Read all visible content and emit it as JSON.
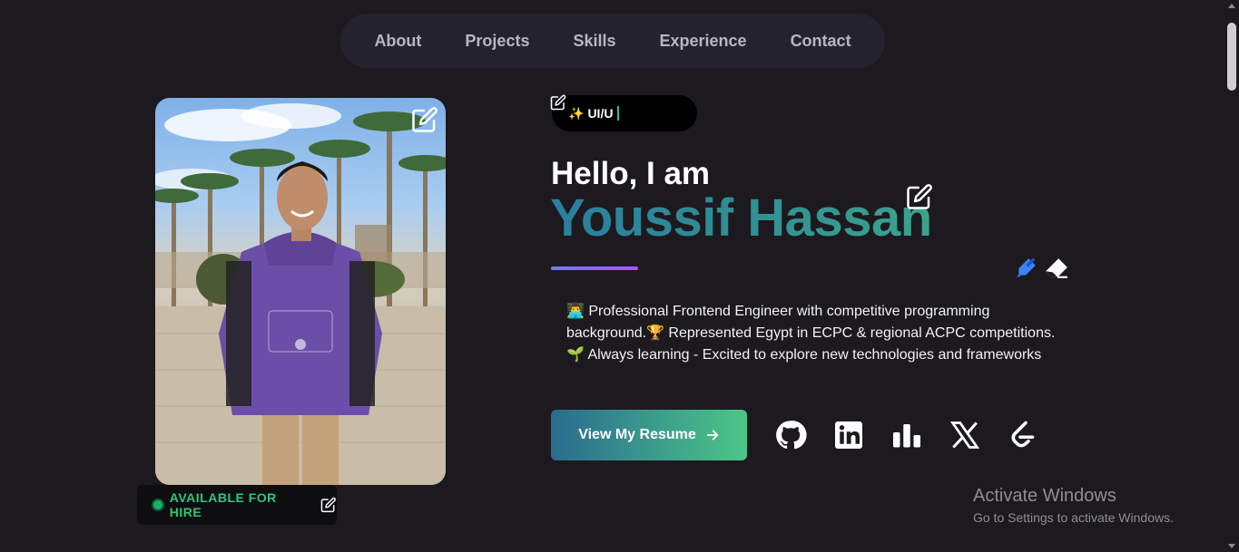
{
  "nav": {
    "items": [
      {
        "label": "About"
      },
      {
        "label": "Projects"
      },
      {
        "label": "Skills"
      },
      {
        "label": "Experience"
      },
      {
        "label": "Contact"
      }
    ]
  },
  "profile": {
    "availability": "AVAILABLE FOR HIRE",
    "role_prefix": "✨",
    "role_typing": "UI/U",
    "greeting": "Hello, I am",
    "name": "Youssif Hassan",
    "bio": [
      "👨‍💻 Professional Frontend Engineer with competitive programming",
      "background.🏆 Represented Egypt in ECPC & regional ACPC competitions.",
      "🌱 Always learning - Excited to explore new technologies and frameworks"
    ]
  },
  "actions": {
    "resume_label": "View My Resume",
    "resume_icon": "arrow-right-icon"
  },
  "social": [
    {
      "icon": "github-icon"
    },
    {
      "icon": "linkedin-icon"
    },
    {
      "icon": "bar-chart-icon"
    },
    {
      "icon": "x-icon"
    },
    {
      "icon": "leetcode-icon"
    }
  ],
  "tools": {
    "brush": "brush-icon",
    "eraser": "eraser-icon"
  },
  "os_watermark": {
    "title": "Activate Windows",
    "subtitle": "Go to Settings to activate Windows."
  },
  "colors": {
    "background": "#1c1a1f",
    "nav_bg": "#252230",
    "accent_green": "#2cc77d",
    "name_gradient": [
      "#2a7f9e",
      "#3aa48c"
    ],
    "underline_gradient": [
      "#6f7ef5",
      "#b051f0"
    ]
  }
}
